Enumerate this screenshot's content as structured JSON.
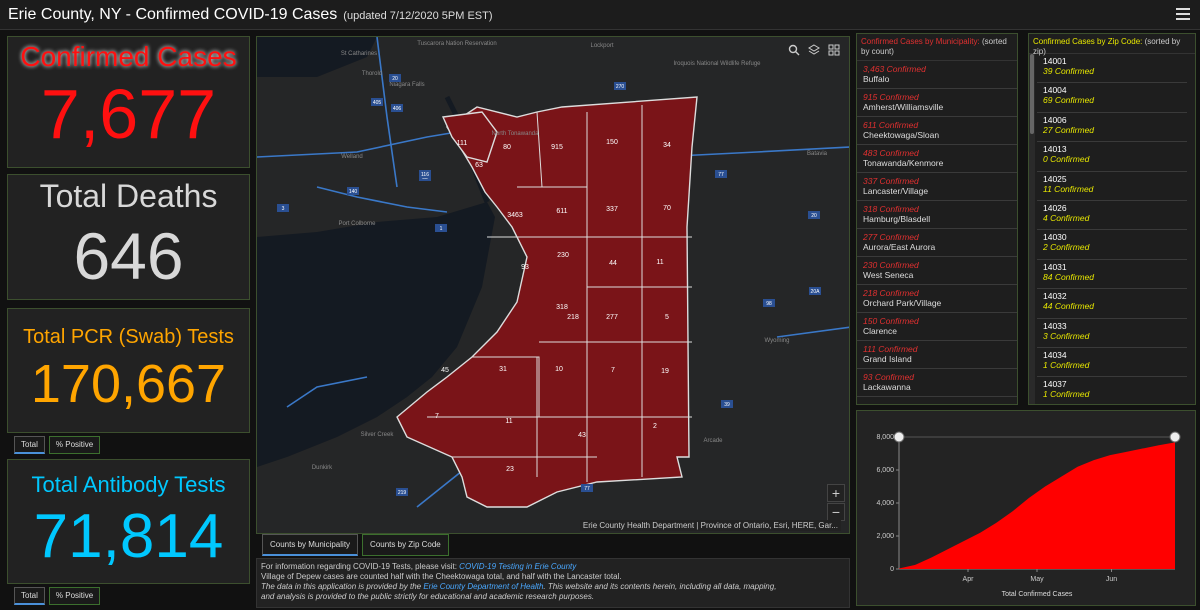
{
  "header": {
    "title": "Erie County, NY - Confirmed COVID-19 Cases",
    "updated": "(updated 7/12/2020 5PM EST)"
  },
  "stats": {
    "confirmed": {
      "label": "Confirmed Cases",
      "value": "7,677",
      "color": "#ff1010"
    },
    "deaths": {
      "label": "Total Deaths",
      "value": "646",
      "color": "#d8d8d8"
    },
    "pcr": {
      "label": "Total PCR (Swab) Tests",
      "value": "170,667",
      "color": "#ffa500"
    },
    "antibody": {
      "label": "Total Antibody Tests",
      "value": "71,814",
      "color": "#00c8ff"
    }
  },
  "stat_buttons": {
    "total": "Total",
    "positive": "% Positive"
  },
  "map": {
    "municipality_counts": [
      "111",
      "80",
      "63",
      "915",
      "150",
      "34",
      "3463",
      "611",
      "337",
      "70",
      "230",
      "44",
      "11",
      "93",
      "318",
      "277",
      "5",
      "31",
      "10",
      "7",
      "19",
      "45",
      "7",
      "11",
      "43",
      "2",
      "23",
      "218"
    ],
    "place_labels": [
      "St Catharines",
      "Thorold",
      "Tuscarora Nation Reservation",
      "Lockport",
      "Iroquois National Wildlife Refuge",
      "Niagara Falls",
      "Welland",
      "North Tonawanda",
      "Port Colborne",
      "Batavia",
      "Wyoming",
      "Silver Creek",
      "Dunkirk",
      "Arcade"
    ],
    "route_labels": [
      "20",
      "405",
      "406",
      "140",
      "58",
      "3",
      "1",
      "116",
      "270",
      "77",
      "20",
      "20A",
      "98",
      "39",
      "219",
      "77"
    ],
    "attribution": "Erie County Health Department | Province of Ontario, Esri, HERE, Gar...",
    "tools": [
      "search-icon",
      "layers-icon",
      "basemap-icon"
    ],
    "zoom_in": "+",
    "zoom_out": "−",
    "tabs": [
      "Counts by Municipality",
      "Counts by Zip Code"
    ]
  },
  "info": {
    "line1_prefix": "For information regarding COVID-19 Tests,  please visit:",
    "line1_link": "COVID-19 Testing in Erie County",
    "line2": "Village of Depew cases are counted half with the Cheektowaga total, and half with the Lancaster total.",
    "line3_prefix": "The data in this application is provided by the",
    "line3_link": "Erie County Department of Health",
    "line3_suffix": ". This website and its contents herein, including all data, mapping,",
    "line4": "and analysis is provided to the public strictly for educational and academic research purposes."
  },
  "municipality_list": {
    "title": "Confirmed Cases by Municipality:",
    "subtitle": "(sorted by count)",
    "items": [
      {
        "count": "3,463 Confirmed",
        "name": "Buffalo"
      },
      {
        "count": "915 Confirmed",
        "name": "Amherst/Williamsville"
      },
      {
        "count": "611 Confirmed",
        "name": "Cheektowaga/Sloan"
      },
      {
        "count": "483 Confirmed",
        "name": "Tonawanda/Kenmore"
      },
      {
        "count": "337 Confirmed",
        "name": "Lancaster/Village"
      },
      {
        "count": "318 Confirmed",
        "name": "Hamburg/Blasdell"
      },
      {
        "count": "277 Confirmed",
        "name": "Aurora/East Aurora"
      },
      {
        "count": "230 Confirmed",
        "name": "West Seneca"
      },
      {
        "count": "218 Confirmed",
        "name": "Orchard Park/Village"
      },
      {
        "count": "150 Confirmed",
        "name": "Clarence"
      },
      {
        "count": "111 Confirmed",
        "name": "Grand Island"
      },
      {
        "count": "93 Confirmed",
        "name": "Lackawanna"
      }
    ]
  },
  "zip_list": {
    "title": "Confirmed Cases by Zip Code:",
    "subtitle": "(sorted by zip)",
    "items": [
      {
        "zip": "14001",
        "count": "39 Confirmed"
      },
      {
        "zip": "14004",
        "count": "69 Confirmed"
      },
      {
        "zip": "14006",
        "count": "27 Confirmed"
      },
      {
        "zip": "14013",
        "count": "0 Confirmed"
      },
      {
        "zip": "14025",
        "count": "11 Confirmed"
      },
      {
        "zip": "14026",
        "count": "4 Confirmed"
      },
      {
        "zip": "14030",
        "count": "2 Confirmed"
      },
      {
        "zip": "14031",
        "count": "84 Confirmed"
      },
      {
        "zip": "14032",
        "count": "44 Confirmed"
      },
      {
        "zip": "14033",
        "count": "3 Confirmed"
      },
      {
        "zip": "14034",
        "count": "1 Confirmed"
      },
      {
        "zip": "14037",
        "count": "1 Confirmed"
      }
    ]
  },
  "chart_data": {
    "type": "area",
    "xlabel": "Total Confirmed Cases",
    "ylabel": "",
    "ylim": [
      0,
      8000
    ],
    "yticks": [
      "0",
      "2,000",
      "4,000",
      "6,000",
      "8,000"
    ],
    "xticks": [
      "Apr",
      "May",
      "Jun"
    ],
    "series_color": "#ff0000",
    "x": [
      "Mar 15",
      "Mar 22",
      "Mar 29",
      "Apr 5",
      "Apr 12",
      "Apr 19",
      "Apr 26",
      "May 3",
      "May 10",
      "May 17",
      "May 24",
      "May 31",
      "Jun 7",
      "Jun 14",
      "Jun 21",
      "Jun 28",
      "Jul 5",
      "Jul 12"
    ],
    "values": [
      30,
      250,
      700,
      1200,
      1700,
      2200,
      2800,
      3500,
      4300,
      5000,
      5600,
      6200,
      6600,
      6900,
      7100,
      7300,
      7500,
      7677
    ]
  }
}
